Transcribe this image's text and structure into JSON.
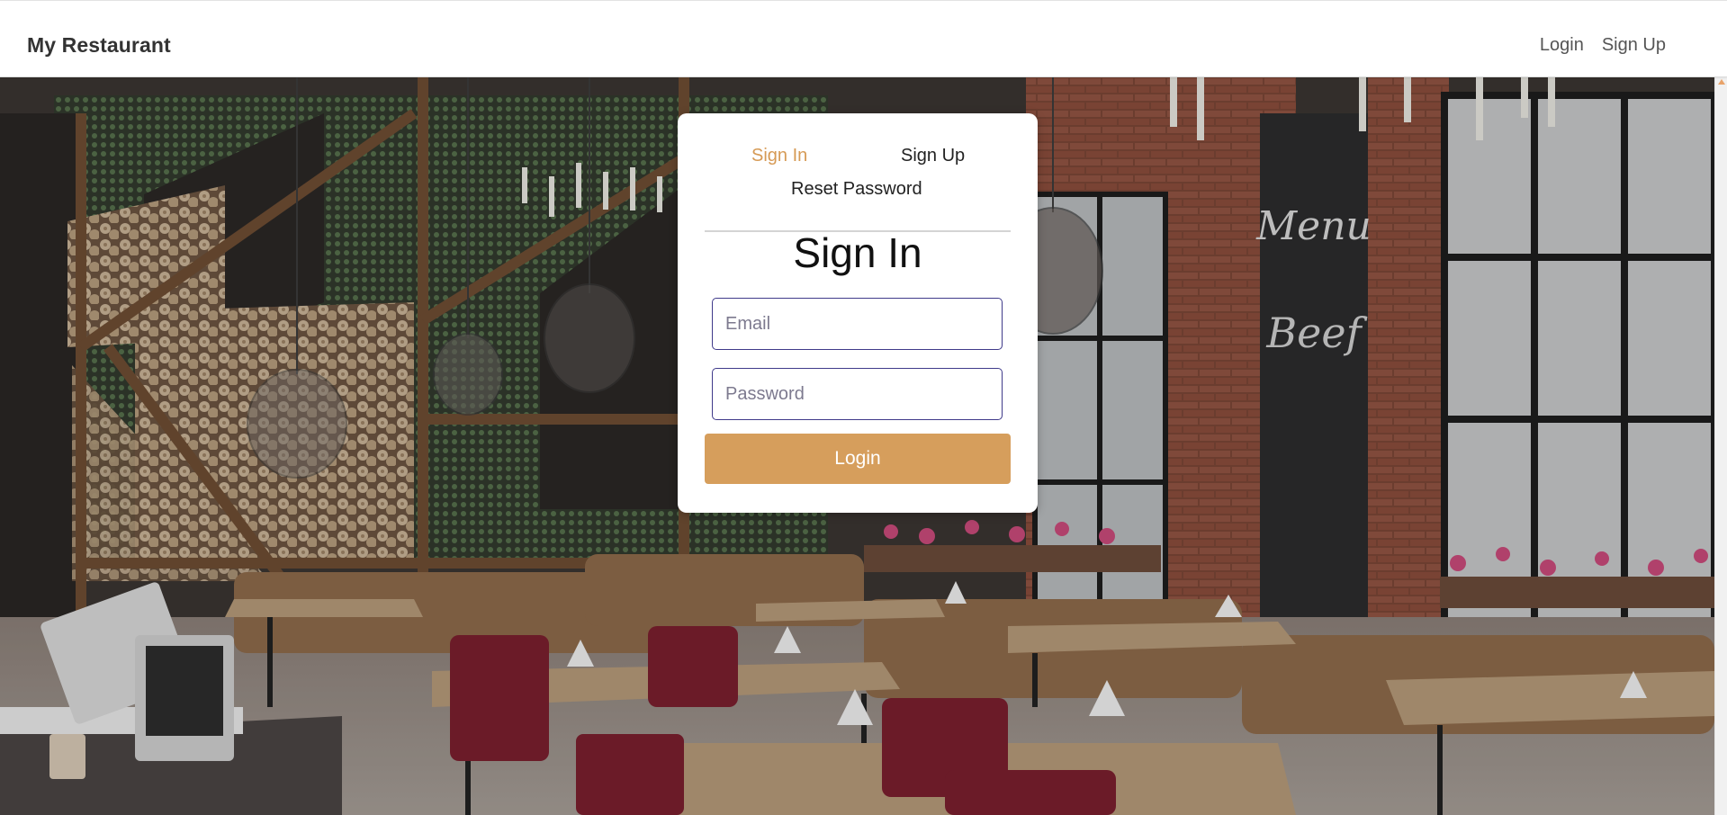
{
  "navbar": {
    "brand": "My Restaurant",
    "links": [
      "Login",
      "Sign Up"
    ]
  },
  "auth_card": {
    "tabs": {
      "sign_in": "Sign In",
      "sign_up": "Sign Up",
      "reset_password": "Reset Password",
      "active": "sign_in"
    },
    "title": "Sign In",
    "email_placeholder": "Email",
    "password_placeholder": "Password",
    "submit_label": "Login"
  },
  "colors": {
    "accent": "#d69e5c",
    "active_tab": "#d69a55",
    "input_border": "#3f3a8a"
  },
  "background": {
    "description_icon": "restaurant-interior-photo"
  }
}
